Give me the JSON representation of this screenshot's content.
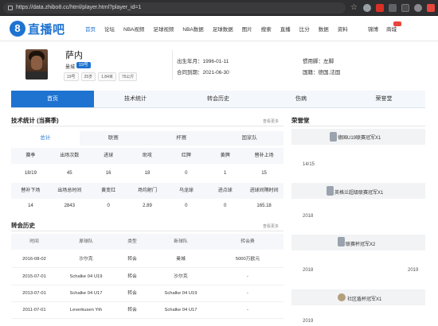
{
  "browser": {
    "url": "https://data.zhibo8.cc/html/player.html?player_id=1"
  },
  "header": {
    "logo_mark": "8",
    "logo_text": "直播吧",
    "nav": [
      "首页",
      "论坛",
      "NBA视频",
      "足球视频",
      "NBA数据",
      "足球数据",
      "图片",
      "搜索",
      "直播",
      "比分",
      "数据",
      "资料"
    ],
    "nav_right": [
      "锦博",
      "商城"
    ]
  },
  "player": {
    "name": "萨内",
    "team": "曼城",
    "number_badge": "19号",
    "meta": [
      "19号",
      "25岁",
      "1.84米",
      "75公斤"
    ],
    "birth_label": "出生年月：",
    "birth_value": "1996-01-11",
    "contract_label": "合同到期：",
    "contract_value": "2021-06-30",
    "foot_label": "惯用脚：",
    "foot_value": "左脚",
    "nation_label": "国籍：",
    "nation_value": "德国,法国"
  },
  "tabs": [
    {
      "label": "首页",
      "active": true
    },
    {
      "label": "技术统计",
      "active": false
    },
    {
      "label": "转会历史",
      "active": false
    },
    {
      "label": "伤病",
      "active": false
    },
    {
      "label": "荣誉堂",
      "active": false
    }
  ],
  "stats": {
    "title": "技术统计 (当赛季)",
    "more": "查看更多",
    "subtabs": [
      {
        "label": "总计",
        "active": true
      },
      {
        "label": "联赛",
        "active": false
      },
      {
        "label": "杯赛",
        "active": false
      },
      {
        "label": "国家队",
        "active": false
      }
    ],
    "head1": [
      "赛季",
      "出场次数",
      "进球",
      "助攻",
      "红牌",
      "黄牌",
      "替补上场"
    ],
    "row1": [
      "18/19",
      "45",
      "16",
      "18",
      "0",
      "1",
      "15"
    ],
    "head2": [
      "替补下场",
      "出场总时间",
      "黄变红",
      "场均射门",
      "乌龙球",
      "进点球",
      "进球间隔时间"
    ],
    "row2": [
      "14",
      "2843",
      "0",
      "2.89",
      "0",
      "0",
      "165.18"
    ]
  },
  "transfers": {
    "title": "转会历史",
    "more": "查看更多",
    "head": [
      "时间",
      "原球队",
      "类型",
      "新球队",
      "转会费"
    ],
    "rows": [
      [
        "2016-08-02",
        "沙尔克",
        "转会",
        "曼城",
        "5000万欧元"
      ],
      [
        "2015-07-01",
        "Schalke 04 U19",
        "转会",
        "沙尔克",
        "-"
      ],
      [
        "2013-07-01",
        "Schalke 04 U17",
        "转会",
        "Schalke 04 U19",
        "-"
      ],
      [
        "2011-07-01",
        "Leverkusen Yth",
        "转会",
        "Schalke 04 U17",
        "-"
      ]
    ]
  },
  "honors": {
    "title": "荣誉堂",
    "items": [
      {
        "label": "德国U19联赛冠军X1",
        "years": [
          "14/15"
        ]
      },
      {
        "label": "英格兰超级联赛冠军X1",
        "years": [
          "2018"
        ]
      },
      {
        "label": "联赛杯冠军X2",
        "years": [
          "2018",
          "2019"
        ]
      },
      {
        "label": "社区盾杯冠军X1",
        "years": [
          "2019"
        ]
      }
    ]
  }
}
